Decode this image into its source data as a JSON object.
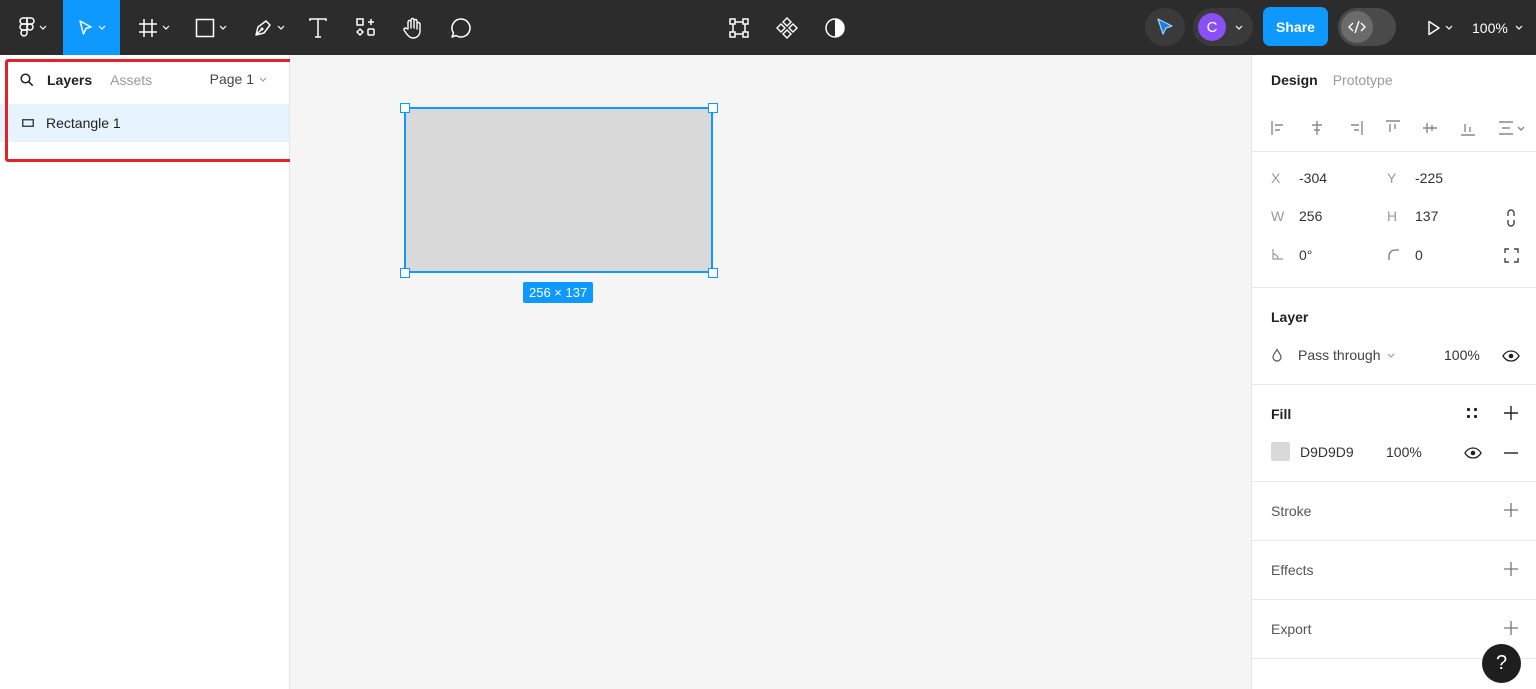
{
  "toolbar": {
    "zoom": "100%",
    "share_label": "Share",
    "avatar_initial": "C",
    "icons": [
      "figma-menu-icon",
      "move-tool-icon",
      "frame-tool-icon",
      "rectangle-tool-icon",
      "pen-tool-icon",
      "text-tool-icon",
      "resources-icon",
      "hand-tool-icon",
      "comment-tool-icon",
      "edit-object-icon",
      "component-icon",
      "mask-icon",
      "present-icon"
    ]
  },
  "left_panel": {
    "tabs": [
      "Layers",
      "Assets"
    ],
    "page": "Page 1",
    "layers": [
      {
        "name": "Rectangle 1",
        "icon": "rectangle-layer-icon"
      }
    ]
  },
  "canvas": {
    "size_badge": "256 × 137",
    "rect_fill": "#d9d9d9",
    "selection_color": "#0d99ff"
  },
  "right_panel": {
    "tabs": [
      "Design",
      "Prototype"
    ],
    "props": {
      "x_label": "X",
      "x": "-304",
      "y_label": "Y",
      "y": "-225",
      "w_label": "W",
      "w": "256",
      "h_label": "H",
      "h": "137",
      "rotation": "0°",
      "radius": "0"
    },
    "layer": {
      "title": "Layer",
      "blend": "Pass through",
      "opacity": "100%"
    },
    "fill": {
      "title": "Fill",
      "hex": "D9D9D9",
      "opacity": "100%"
    },
    "stroke_title": "Stroke",
    "effects_title": "Effects",
    "export_title": "Export"
  },
  "help_label": "?"
}
